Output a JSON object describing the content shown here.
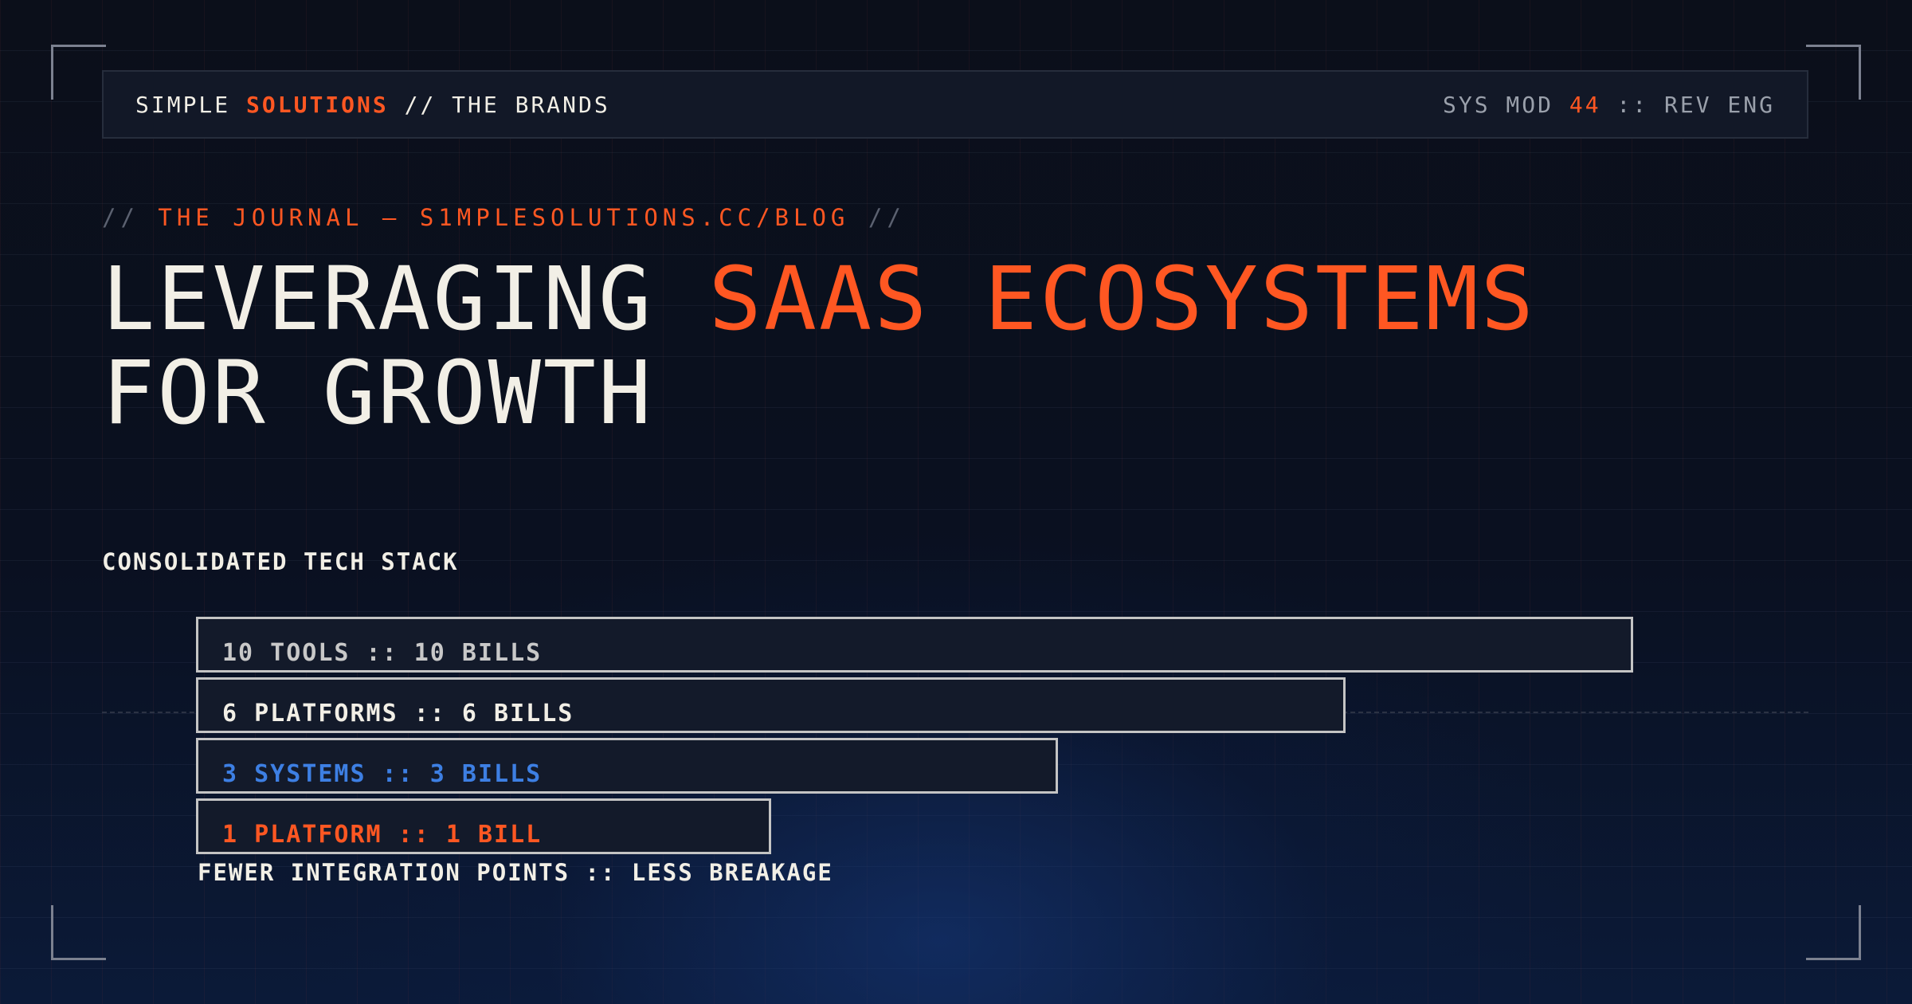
{
  "header": {
    "brand_pre": "SIMPLE ",
    "brand_accent": "SOLUTIONS",
    "brand_post": " // THE BRANDS",
    "sys_pre": "SYS MOD ",
    "sys_accent": "44",
    "sys_post": " :: REV ENG"
  },
  "kicker": {
    "open": "// ",
    "text": "THE JOURNAL — S1MPLESOLUTIONS.CC/BLOG",
    "close": " //"
  },
  "title": {
    "part1": "LEVERAGING ",
    "accent": "SAAS ECOSYSTEMS",
    "line2": "FOR GROWTH"
  },
  "section_label": "CONSOLIDATED TECH STACK",
  "colors": {
    "accent": "#ff5722",
    "blue": "#3d7fe3",
    "text": "#f2efe6",
    "muted": "#c8c8c8"
  },
  "chart_data": {
    "type": "bar",
    "orientation": "horizontal",
    "categories": [
      "10 TOOLS :: 10 BILLS",
      "6 PLATFORMS :: 6 BILLS",
      "3 SYSTEMS :: 3 BILLS",
      "1 PLATFORM :: 1 BILL"
    ],
    "values": [
      10,
      8,
      6,
      4
    ],
    "label_colors": [
      "#c8c8c8",
      "#f2efe6",
      "#3d7fe3",
      "#ff5722"
    ],
    "title": "CONSOLIDATED TECH STACK",
    "xlim": [
      0,
      10
    ]
  },
  "footnote": "FEWER INTEGRATION POINTS :: LESS BREAKAGE"
}
